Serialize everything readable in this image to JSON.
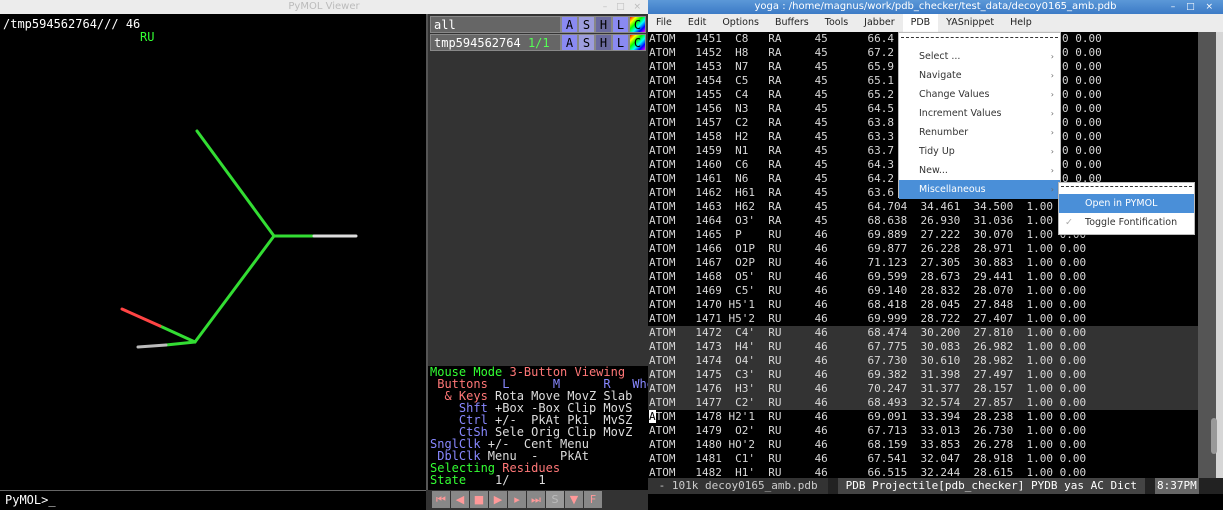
{
  "pymol": {
    "title": "PyMOL Viewer",
    "window_buttons": "– □ ×",
    "selection_path": "/tmp594562764/// 46",
    "selection_resname": "RU",
    "objects": [
      {
        "name": "all",
        "count": "",
        "buttons": [
          "A",
          "S",
          "H",
          "L",
          "C"
        ]
      },
      {
        "name": "tmp594562764",
        "count": "1/1",
        "buttons": [
          "A",
          "S",
          "H",
          "L",
          "C"
        ]
      }
    ],
    "mouse_mode": {
      "title_a": "Mouse Mode ",
      "title_b": "3-Button Viewing",
      "buttons_label": " Buttons",
      "cols": [
        "  L    ",
        "  M    ",
        "  R  ",
        " Wheel"
      ],
      "rows": [
        {
          "label": "  & Keys",
          "vals": " Rota Move MovZ Slab"
        },
        {
          "label": "    Shft",
          "vals": " +Box -Box Clip MovS"
        },
        {
          "label": "    Ctrl",
          "vals": " +/-  PkAt Pk1  MvSZ"
        },
        {
          "label": "    CtSh",
          "vals": " Sele Orig Clip MovZ"
        },
        {
          "label": "SnglClk",
          "vals": " +/-  Cent Menu"
        },
        {
          "label": " DblClk",
          "vals": " Menu  -   PkAt"
        }
      ],
      "selecting_a": "Selecting ",
      "selecting_b": "Residues",
      "state_label": "State",
      "state_value": "    1/    1"
    },
    "transport": [
      "⏮",
      "◀",
      "■",
      "▶",
      "▸",
      "⏭",
      "S",
      "▼",
      "F"
    ],
    "command_prompt": "PyMOL>_",
    "colors": {
      "carbon": "#33dd33",
      "oxygen": "#ff4444",
      "hydrogen": "#dddddd"
    }
  },
  "emacs": {
    "title": "yoga : /home/magnus/work/pdb_checker/test_data/decoy0165_amb.pdb",
    "window_buttons": "– □ ×",
    "menubar": [
      "File",
      "Edit",
      "Options",
      "Buffers",
      "Tools",
      "Jabber",
      "PDB",
      "YASnippet",
      "Help"
    ],
    "active_menu": "PDB",
    "lines": [
      "ATOM   1451  C8   RA     45      66.4",
      "ATOM   1452  H8   RA     45      67.2",
      "ATOM   1453  N7   RA     45      65.9",
      "ATOM   1454  C5   RA     45      65.1",
      "ATOM   1455  C4   RA     45      65.2",
      "ATOM   1456  N3   RA     45      64.5",
      "ATOM   1457  C2   RA     45      63.8",
      "ATOM   1458  H2   RA     45      63.3",
      "ATOM   1459  N1   RA     45      63.7",
      "ATOM   1460  C6   RA     45      64.3",
      "ATOM   1461  N6   RA     45      64.2",
      "ATOM   1462  H61  RA     45      63.6",
      "ATOM   1463  H62  RA     45      64.704  34.461  34.500  1.00 0.00",
      "ATOM   1464  O3'  RA     45      68.638  26.930  31.036  1.00 0.00",
      "ATOM   1465  P    RU     46      69.889  27.222  30.070  1.00 0.00",
      "ATOM   1466  O1P  RU     46      69.877  26.228  28.971  1.00 0.00",
      "ATOM   1467  O2P  RU     46      71.123  27.305  30.883  1.00 0.00",
      "ATOM   1468  O5'  RU     46      69.599  28.673  29.441  1.00 0.00",
      "ATOM   1469  C5'  RU     46      69.140  28.832  28.070  1.00 0.00",
      "ATOM   1470 H5'1  RU     46      68.418  28.045  27.848  1.00 0.00",
      "ATOM   1471 H5'2  RU     46      69.999  28.722  27.407  1.00 0.00",
      "ATOM   1472  C4'  RU     46      68.474  30.200  27.810  1.00 0.00",
      "ATOM   1473  H4'  RU     46      67.775  30.083  26.982  1.00 0.00",
      "ATOM   1474  O4'  RU     46      67.730  30.610  28.982  1.00 0.00",
      "ATOM   1475  C3'  RU     46      69.382  31.398  27.497  1.00 0.00",
      "ATOM   1476  H3'  RU     46      70.247  31.377  28.157  1.00 0.00",
      "ATOM   1477  C2'  RU     46      68.493  32.574  27.857  1.00 0.00",
      "ATOM   1478 H2'1  RU     46      69.091  33.394  28.238  1.00 0.00",
      "ATOM   1479  O2'  RU     46      67.713  33.013  26.730  1.00 0.00",
      "ATOM   1480 HO'2  RU     46      68.159  33.853  26.278  1.00 0.00",
      "ATOM   1481  C1'  RU     46      67.541  32.047  28.918  1.00 0.00",
      "ATOM   1482  H1'  RU     46      66.515  32.244  28.615  1.00 0.00"
    ],
    "right_tail": "0 0.00",
    "pdb_menu": [
      {
        "label": "Select ...",
        "arrow": "›"
      },
      {
        "label": "Navigate",
        "arrow": "›"
      },
      {
        "label": "Change Values",
        "arrow": "›"
      },
      {
        "label": "Increment Values",
        "arrow": "›"
      },
      {
        "label": "Renumber",
        "arrow": "›"
      },
      {
        "label": "Tidy Up",
        "arrow": "›"
      },
      {
        "label": "New...",
        "arrow": "›"
      },
      {
        "label": "Miscellaneous",
        "arrow": "›"
      }
    ],
    "misc_menu": [
      {
        "label": "Open in PYMOL",
        "check": ""
      },
      {
        "label": "Toggle Fontification",
        "check": "✓"
      }
    ],
    "modeline": {
      "buffer_info": " - 101k decoy0165_amb.pdb",
      "modes": "PDB Projectile[pdb_checker] PYDB yas AC Dict",
      "time": "8:37PM"
    }
  }
}
